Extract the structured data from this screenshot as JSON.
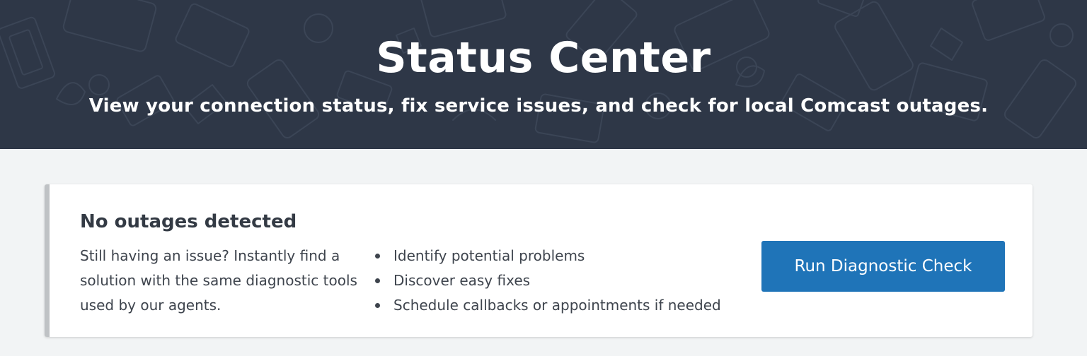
{
  "header": {
    "title": "Status Center",
    "subtitle": "View your connection status, fix service issues, and check for local Comcast outages.",
    "background_color": "#2e3747"
  },
  "status_card": {
    "title": "No outages detected",
    "description": "Still having an issue? Instantly find a solution with the same diagnostic tools used by our agents.",
    "features": [
      "Identify potential problems",
      "Discover easy fixes",
      "Schedule callbacks or appointments if needed"
    ],
    "action_label": "Run Diagnostic Check",
    "action_color": "#1f74b8",
    "accent_color": "#bfc2c5"
  }
}
